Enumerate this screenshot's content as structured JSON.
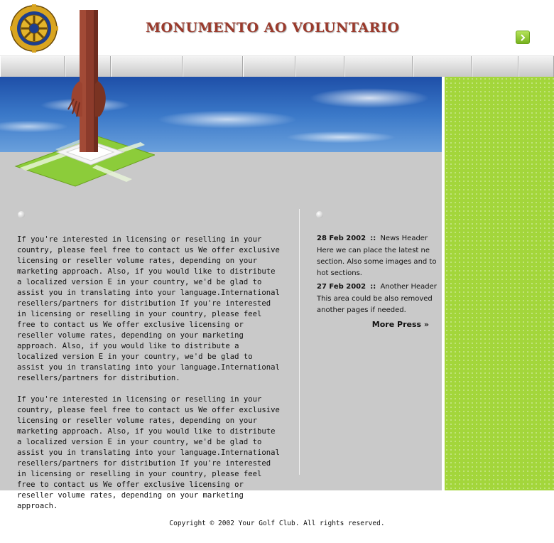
{
  "header": {
    "title": "MONUMENTO AO VOLUNTARIO",
    "logo_icon": "rotary-wheel-logo",
    "next_icon": "chevron-right-icon"
  },
  "nav": {
    "tab_count": 10
  },
  "main": {
    "paragraphs": [
      "If you're interested in licensing or reselling  in your country, please feel free to contact us We offer exclusive licensing or reseller volume rates, depending on your marketing approach. Also, if you would like to distribute a localized version E in your country, we'd be glad to assist you in translating  into your language.International resellers/partners for distribution If you're interested in licensing or reselling  in your country, please feel free to contact us We offer exclusive licensing or reseller volume rates, depending on your marketing approach. Also, if you would like to distribute a localized version E in your country, we'd be glad to assist you in translating  into your language.International resellers/partners for distribution.",
      "If you're interested in licensing or reselling  in your country, please feel free to contact us We offer exclusive licensing or reseller volume rates, depending on your marketing approach. Also, if you would like to distribute a localized version E in your country, we'd be glad to assist you in translating  into your language.International resellers/partners for distribution If you're interested in licensing or reselling  in your country, please feel free to contact us We offer exclusive licensing or reseller volume rates, depending on your marketing approach."
    ]
  },
  "news": {
    "items": [
      {
        "date": "28 Feb 2002",
        "sep": "::",
        "header": "News Header",
        "body": "Here we can place the latest ne section. Also some images and to hot sections."
      },
      {
        "date": "27 Feb 2002",
        "sep": "::",
        "header": "Another Header",
        "body": "This area could be also removed another pages if needed."
      }
    ],
    "more_label": "More Press »"
  },
  "footer": {
    "copyright": "Copyright © 2002 Your Golf Club. All rights reserved."
  },
  "colors": {
    "title": "#9a3a2c",
    "sidebar_green": "#a3d63b",
    "main_gray": "#c9c9c9"
  }
}
